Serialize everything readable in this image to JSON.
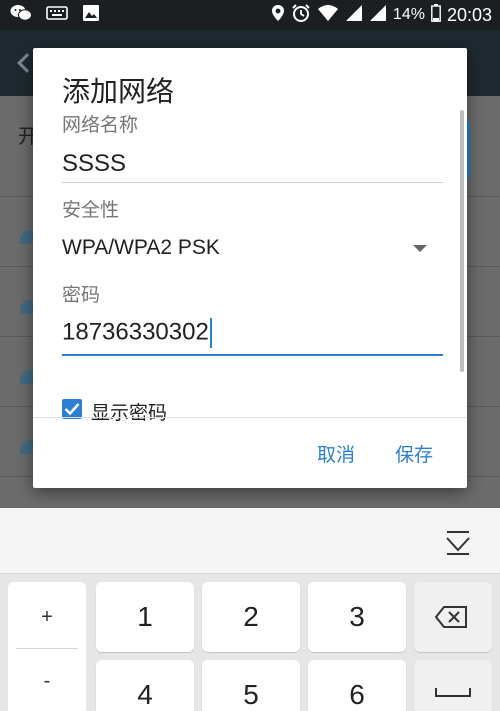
{
  "status_bar": {
    "battery": "14%",
    "time": "20:03"
  },
  "background": {
    "switch_label": "开"
  },
  "dialog": {
    "title": "添加网络",
    "ssid_label": "网络名称",
    "ssid_value": "SSSS",
    "security_label": "安全性",
    "security_value": "WPA/WPA2 PSK",
    "password_label": "密码",
    "password_value": "18736330302",
    "show_password_label": "显示密码",
    "show_password_checked": true,
    "cancel_label": "取消",
    "save_label": "保存"
  },
  "keyboard": {
    "side_symbols": [
      "+",
      "-"
    ],
    "row1": [
      "1",
      "2",
      "3"
    ],
    "row2": [
      "4",
      "5",
      "6"
    ]
  },
  "colors": {
    "accent": "#2d7fd0",
    "status_bar": "#1c1f22"
  }
}
